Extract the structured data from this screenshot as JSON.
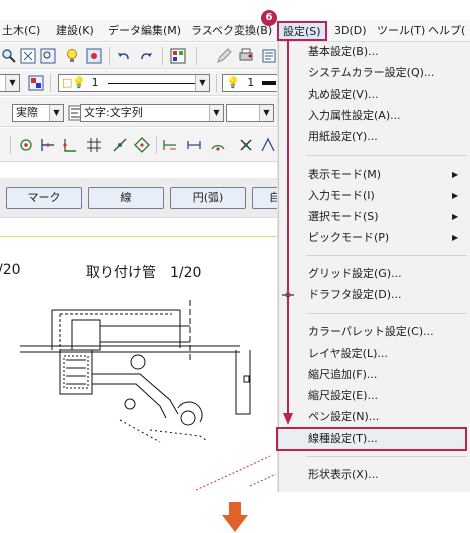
{
  "menubar": {
    "items": [
      {
        "label": "土木(C)"
      },
      {
        "label": "建設(K)"
      },
      {
        "label": "データ編集(M)"
      },
      {
        "label": "ラスベク変換(B)"
      },
      {
        "label": "設定(S)"
      },
      {
        "label": "3D(D)"
      },
      {
        "label": "ツール(T)"
      },
      {
        "label": "ヘルプ("
      }
    ]
  },
  "toolbar": {
    "line_color_value": "1",
    "line_type_value": "1",
    "line_width_value": "1",
    "scale_mode_value": "実際",
    "text_type_value": "文字:文字列"
  },
  "command_buttons": [
    "マーク",
    "線",
    "円(弧)",
    "自"
  ],
  "drawing": {
    "title_left": "/20",
    "title_main": "取り付け管　1/20"
  },
  "dropdown": {
    "items": [
      {
        "label": "基本設定(B)..."
      },
      {
        "label": "システムカラー設定(Q)..."
      },
      {
        "label": "丸め設定(V)..."
      },
      {
        "label": "入力属性設定(A)..."
      },
      {
        "label": "用紙設定(Y)..."
      },
      {
        "label": "表示モード(M)",
        "submenu": true
      },
      {
        "label": "入力モード(I)",
        "submenu": true
      },
      {
        "label": "選択モード(S)",
        "submenu": true
      },
      {
        "label": "ピックモード(P)",
        "submenu": true
      },
      {
        "label": "グリッド設定(G)..."
      },
      {
        "label": "ドラフタ設定(D)..."
      },
      {
        "label": "カラーパレット設定(C)..."
      },
      {
        "label": "レイヤ設定(L)..."
      },
      {
        "label": "縮尺追加(F)..."
      },
      {
        "label": "縮尺設定(E)..."
      },
      {
        "label": "ペン設定(N)..."
      },
      {
        "label": "線種設定(T)..."
      },
      {
        "label": "形状表示(X)..."
      }
    ]
  },
  "callout": {
    "step": "6"
  },
  "colors": {
    "accent": "#b8264f",
    "arrow": "#e0622b",
    "highlight": "#dbe8f7"
  }
}
